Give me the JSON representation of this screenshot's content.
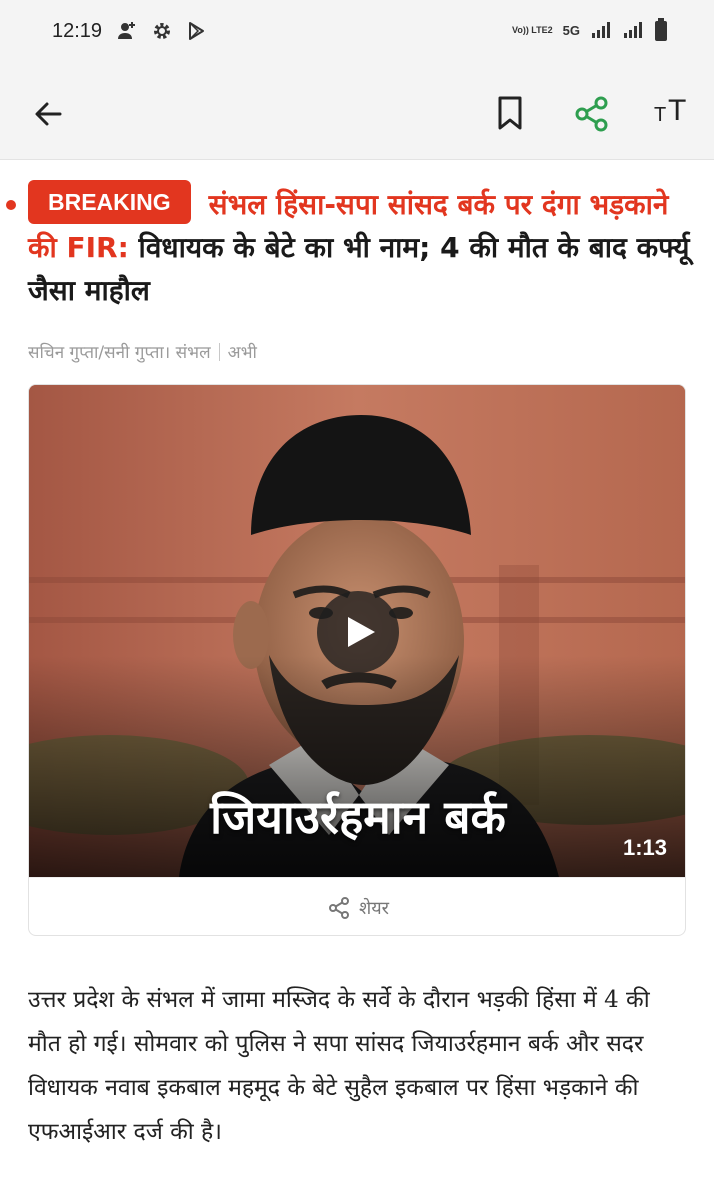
{
  "status_bar": {
    "time": "12:19",
    "left_icons": [
      "add-contact-icon",
      "gear-icon",
      "play-store-icon"
    ],
    "volte_label": "Vo)) LTE2",
    "network_label": "5G",
    "right_icons": [
      "signal-icon",
      "signal-icon",
      "battery-icon"
    ]
  },
  "app_bar": {
    "icons": [
      "back-arrow-icon",
      "bookmark-icon",
      "share-icon",
      "font-size-icon"
    ],
    "font_size_small": "T",
    "font_size_big": "T",
    "accent_color": "#2e9e4f"
  },
  "article": {
    "badge": "BREAKING",
    "kicker": "संभल हिंसा-सपा सांसद बर्क पर दंगा भड़काने की FIR:",
    "title": " विधायक के बेटे का भी नाम; 4 की मौत के बाद कर्फ्यू जैसा माहौल",
    "byline": "सचिन गुप्ता/सनी गुप्ता। संभल",
    "time": "अभी",
    "brand_color": "#e2361f"
  },
  "video": {
    "overlay_text": "जियाउर्रहमान बर्क",
    "duration": "1:13",
    "share_label": "शेयर"
  },
  "body": {
    "paragraph": "उत्तर प्रदेश के संभल में जामा मस्जिद के सर्वे के दौरान भड़की हिंसा में 4 की मौत हो गई। सोमवार को पुलिस ने सपा सांसद जियाउर्रहमान बर्क और सदर विधायक नवाब इकबाल महमूद के बेटे सुहैल इकबाल पर हिंसा भड़काने की एफआईआर दर्ज की है।"
  }
}
